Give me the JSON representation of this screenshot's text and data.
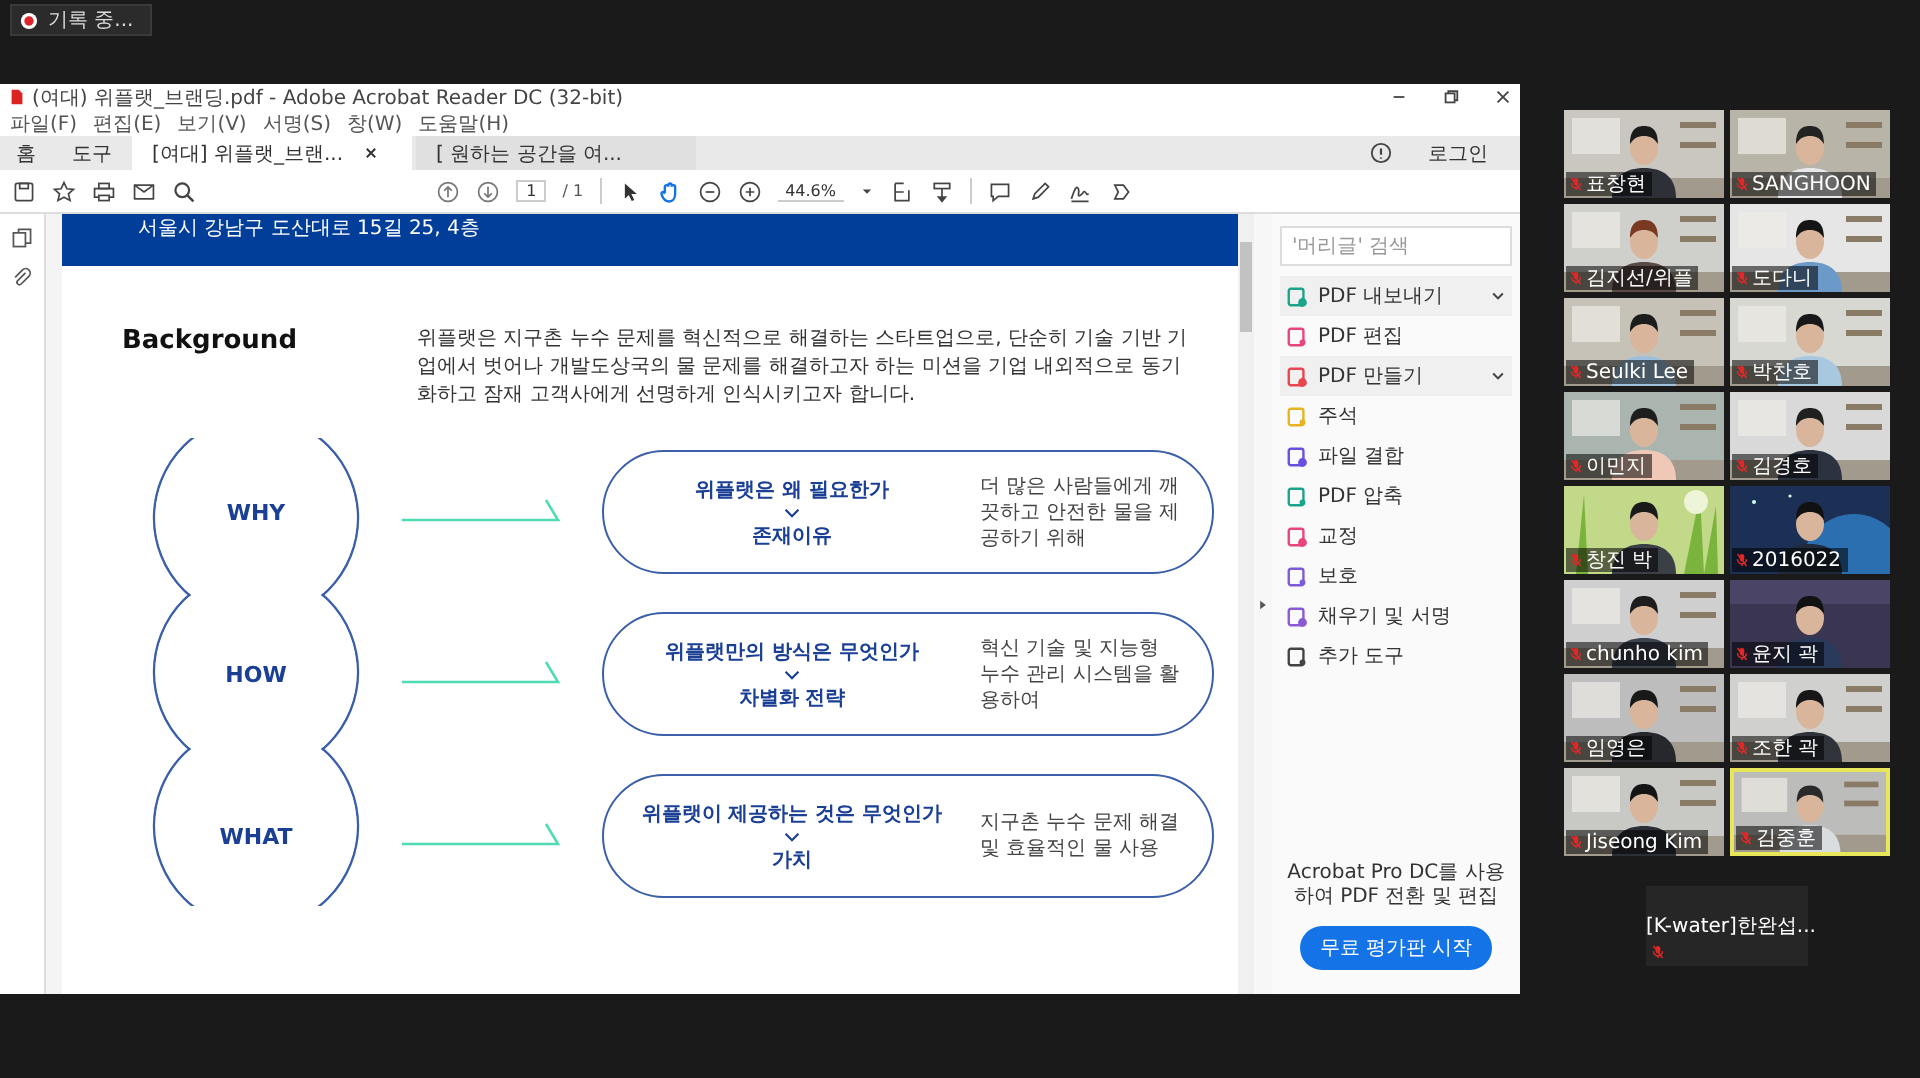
{
  "recording": {
    "label": "기록 중..."
  },
  "window": {
    "title": "(여대) 위플랫_브랜딩.pdf - Adobe Acrobat Reader DC (32-bit)",
    "menu": [
      "파일(F)",
      "편집(E)",
      "보기(V)",
      "서명(S)",
      "창(W)",
      "도움말(H)"
    ],
    "tabs": [
      {
        "label": "홈",
        "kind": "nav",
        "selected": false
      },
      {
        "label": "도구",
        "kind": "nav",
        "selected": false
      },
      {
        "label": "[여대] 위플랫_브랜...",
        "kind": "doc",
        "selected": true
      },
      {
        "label": "[ 원하는 공간을 여...",
        "kind": "doc",
        "selected": false
      }
    ],
    "login": "로그인"
  },
  "toolbar": {
    "page": "1",
    "page_total": "/ 1",
    "zoom": "44.6%",
    "tools": [
      {
        "kind": "pointer",
        "selected": false
      },
      {
        "kind": "hand",
        "selected": true
      }
    ]
  },
  "document": {
    "address": "서울시 강남구 도산대로 15길 25, 4층",
    "heading": "Background",
    "intro": "위플랫은 지구촌 누수 문제를 혁신적으로 해결하는 스타트업으로, 단순히 기술 기반 기업에서 벗어나 개발도상국의 물 문제를 해결하고자 하는 미션을 기업 내외적으로 동기화하고 잠재 고객사에게 선명하게 인식시키고자 합니다.",
    "rows": [
      {
        "circle": "WHY",
        "question": "위플랫은 왜 필요한가",
        "answer": "존재이유",
        "description": "더 많은 사람들에게 깨끗하고 안전한 물을 제공하기 위해"
      },
      {
        "circle": "HOW",
        "question": "위플랫만의 방식은 무엇인가",
        "answer": "차별화 전략",
        "description": "혁신 기술 및 지능형 누수 관리 시스템을 활용하여"
      },
      {
        "circle": "WHAT",
        "question": "위플랫이 제공하는 것은 무엇인가",
        "answer": "가치",
        "description": "지구촌 누수 문제 해결 및 효율적인 물 사용"
      }
    ]
  },
  "tools_pane": {
    "search_placeholder": "'머리글' 검색",
    "items": [
      {
        "label": "PDF 내보내기",
        "color": "#1ba38b",
        "kind": "expandable"
      },
      {
        "label": "PDF 편집",
        "color": "#e8457a",
        "kind": "plain"
      },
      {
        "label": "PDF 만들기",
        "color": "#e8454f",
        "kind": "expandable"
      },
      {
        "label": "주석",
        "color": "#e6b41e",
        "kind": "plain"
      },
      {
        "label": "파일 결합",
        "color": "#6a4ee0",
        "kind": "plain"
      },
      {
        "label": "PDF 압축",
        "color": "#1ba38b",
        "kind": "plain"
      },
      {
        "label": "교정",
        "color": "#e8457a",
        "kind": "plain"
      },
      {
        "label": "보호",
        "color": "#7b5cd6",
        "kind": "plain"
      },
      {
        "label": "채우기 및 서명",
        "color": "#8a5ad6",
        "kind": "plain"
      },
      {
        "label": "추가 도구",
        "color": "#444444",
        "kind": "plain"
      }
    ],
    "promo": "Acrobat Pro DC를 사용하여 PDF 전환 및 편집",
    "promo_button": "무료 평가판 시작"
  },
  "participants": [
    {
      "name": "표창현",
      "muted": true,
      "speaking": false
    },
    {
      "name": "SANGHOON",
      "muted": true,
      "speaking": false
    },
    {
      "name": "김지선/위플",
      "muted": true,
      "speaking": false
    },
    {
      "name": "도다니",
      "muted": true,
      "speaking": false
    },
    {
      "name": "Seulki Lee",
      "muted": true,
      "speaking": false
    },
    {
      "name": "박찬호",
      "muted": true,
      "speaking": false
    },
    {
      "name": "이민지",
      "muted": true,
      "speaking": false
    },
    {
      "name": "김경호",
      "muted": true,
      "speaking": false
    },
    {
      "name": "창진 박",
      "muted": true,
      "speaking": false
    },
    {
      "name": "2016022",
      "muted": true,
      "speaking": false
    },
    {
      "name": "chunho kim",
      "muted": true,
      "speaking": false
    },
    {
      "name": "윤지 곽",
      "muted": true,
      "speaking": false
    },
    {
      "name": "임영은",
      "muted": true,
      "speaking": false
    },
    {
      "name": "조한 곽",
      "muted": true,
      "speaking": false
    },
    {
      "name": "Jiseong Kim",
      "muted": true,
      "speaking": false
    },
    {
      "name": "김중훈",
      "muted": true,
      "speaking": true
    }
  ],
  "overflow_tile": {
    "name": "[K-water]한완섭...",
    "muted": true
  }
}
